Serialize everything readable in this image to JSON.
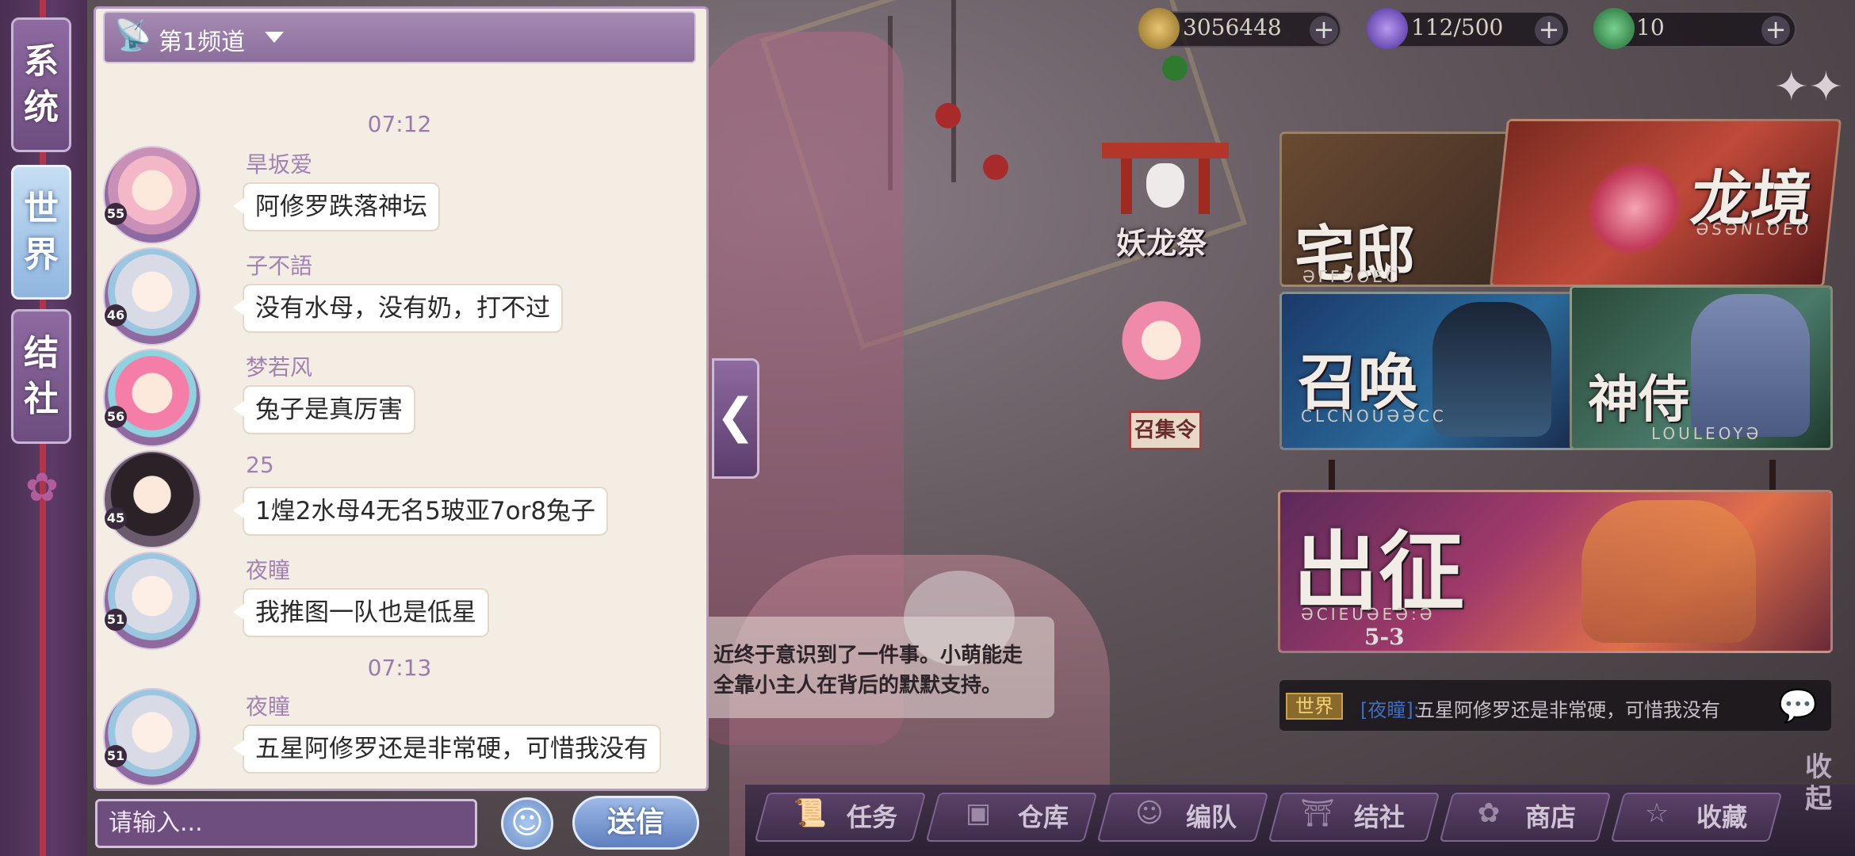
{
  "tabs": [
    {
      "label_top": "系",
      "label_bottom": "统"
    },
    {
      "label_top": "世",
      "label_bottom": "界"
    },
    {
      "label_top": "结",
      "label_bottom": "社"
    }
  ],
  "chat": {
    "channel": "第1频道",
    "input_placeholder": "请输入...",
    "send_label": "送信",
    "messages": [
      {
        "time": "07:12"
      },
      {
        "name": "旱坂爱",
        "level": "55",
        "text": "阿修罗跌落神坛"
      },
      {
        "name": "子不語",
        "level": "46",
        "text": "没有水母，没有奶，打不过"
      },
      {
        "name": "梦若风",
        "level": "56",
        "text": "兔子是真厉害"
      },
      {
        "name": "25",
        "level": "45",
        "text": "1煌2水母4无名5玻亚7or8兔子"
      },
      {
        "name": "夜瞳",
        "level": "51",
        "text": "我推图一队也是低星"
      },
      {
        "time": "07:13"
      },
      {
        "name": "夜瞳",
        "level": "51",
        "text": "五星阿修罗还是非常硬，可惜我没有"
      }
    ]
  },
  "resources": {
    "gold": "3056448",
    "stamina": "112/500",
    "gems": "10",
    "gold_color": "#c9a24a",
    "stamina_color": "#7a5ad0",
    "gem_color": "#3fa060"
  },
  "menu": {
    "event_banner": "妖龙祭",
    "house": {
      "title": "宅邸",
      "sub": "ƏΓFƆOEC"
    },
    "dragon": {
      "title": "龙境",
      "sub": "ƏSƏNLOEO"
    },
    "summon": {
      "title": "召唤",
      "sub": "CLCNOUƏƏCC"
    },
    "shinshi": {
      "title": "神侍",
      "sub": "LOULEOYƏ"
    },
    "gather": "召集令",
    "battle": {
      "title": "出征",
      "sub": "ƏCIEUƏEƏ:Ə",
      "stage": "5-3"
    }
  },
  "dialog": {
    "line1": "近终于意识到了一件事。小萌能走",
    "line2": "全靠小主人在背后的默默支持。"
  },
  "ticker": {
    "channel": "世界",
    "name": "[夜瞳]:",
    "message": "五星阿修罗还是非常硬，可惜我没有"
  },
  "nav": [
    {
      "label": "任务",
      "icon": "scroll-icon"
    },
    {
      "label": "仓库",
      "icon": "chest-icon"
    },
    {
      "label": "编队",
      "icon": "team-icon"
    },
    {
      "label": "结社",
      "icon": "guild-icon"
    },
    {
      "label": "商店",
      "icon": "shop-icon"
    },
    {
      "label": "收藏",
      "icon": "star-icon"
    }
  ],
  "fold_label": "收起"
}
